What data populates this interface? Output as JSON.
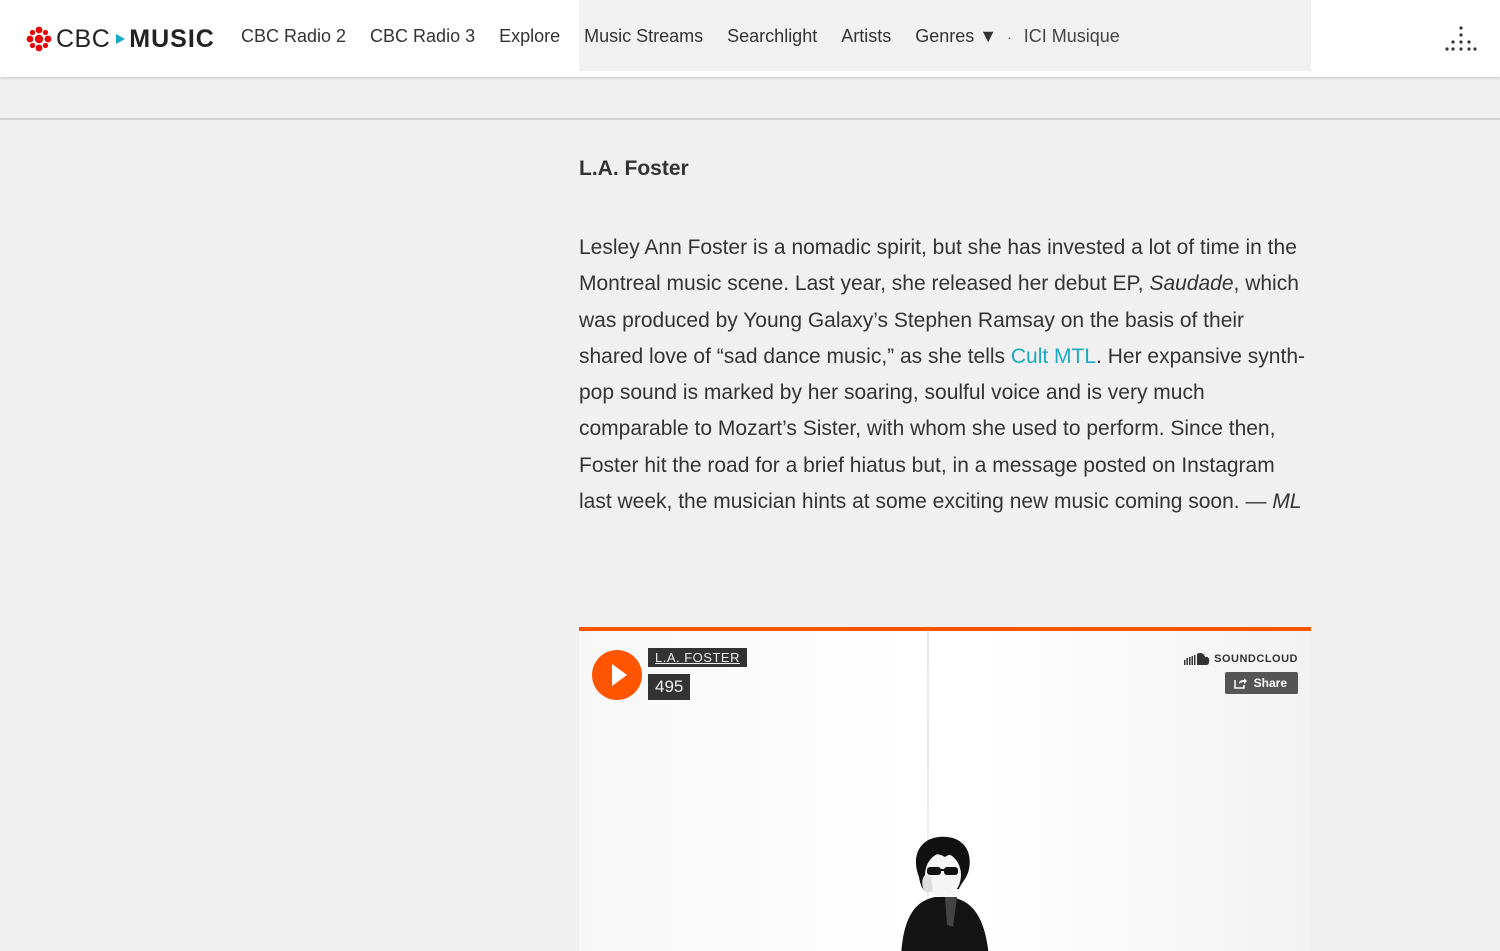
{
  "brand": {
    "logo_text": "CBC",
    "logo_product": "MUSIC",
    "gem_color": "#e60505",
    "accent_color": "#18a9c5"
  },
  "nav": {
    "items": [
      {
        "label": "CBC Radio 2"
      },
      {
        "label": "CBC Radio 3"
      },
      {
        "label": "Explore"
      },
      {
        "label": "Music Streams"
      },
      {
        "label": "Searchlight"
      },
      {
        "label": "Artists"
      },
      {
        "label": "Genres ▼"
      }
    ],
    "separator": "·",
    "ici_label": "ICI Musique",
    "menu_icon": "grid-dots-icon"
  },
  "article": {
    "heading": "L.A. Foster",
    "body_p1": "Lesley Ann Foster is a nomadic spirit, but she has invested a lot of time in the Montreal music scene. Last year, she released her debut EP, ",
    "body_ep": "Saudade",
    "body_p2": ", which was produced by Young Galaxy’s Stephen Ramsay on the basis of their shared love of “sad dance music,” as she tells ",
    "body_link": "Cult MTL",
    "body_p3": ". Her expansive synth-pop sound is marked by her soaring, soulful voice and is very much comparable to Mozart’s Sister, with whom she used to perform. Since then, Foster hit the road for a brief hiatus but, in a message posted on Instagram last week, the musician hints at some exciting new music coming soon. — ",
    "body_sign": "ML",
    "link_color": "#1aa9c0"
  },
  "soundcloud": {
    "artist": "L.A. FOSTER",
    "play_count": "495",
    "brand_label": "SOUNDCLOUD",
    "share_label": "Share",
    "accent_color": "#ff5500"
  }
}
